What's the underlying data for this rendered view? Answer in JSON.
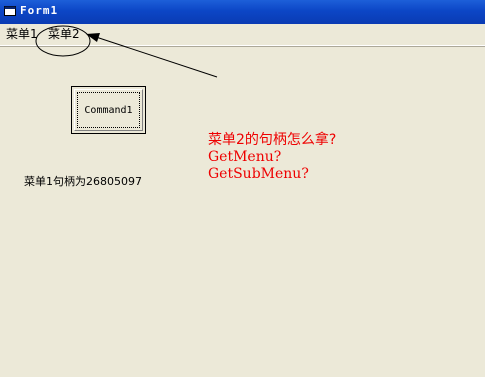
{
  "window": {
    "title": "Form1"
  },
  "menu": {
    "items": [
      {
        "label": "菜单1"
      },
      {
        "label": "菜单2"
      }
    ]
  },
  "form": {
    "command_button_label": "Command1",
    "handle_text": "菜单1句柄为26805097"
  },
  "annotation": {
    "lines": [
      "菜单2的句柄怎么拿?",
      "GetMenu?",
      "GetSubMenu?"
    ],
    "color": "#ee0000"
  },
  "colors": {
    "titlebar": "#0c46c6",
    "background": "#ece9d8"
  }
}
